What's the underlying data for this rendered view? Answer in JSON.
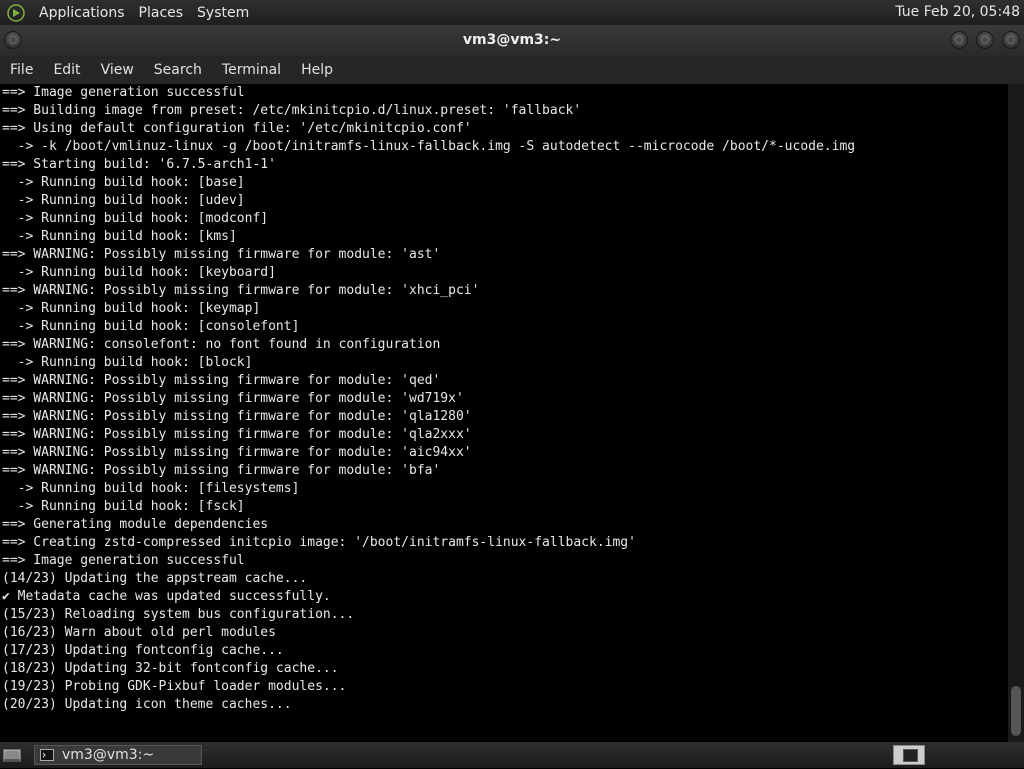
{
  "top_panel": {
    "menus": [
      "Applications",
      "Places",
      "System"
    ],
    "clock": "Tue Feb 20, 05:48"
  },
  "window": {
    "title": "vm3@vm3:~"
  },
  "menubar": {
    "items": [
      "File",
      "Edit",
      "View",
      "Search",
      "Terminal",
      "Help"
    ]
  },
  "terminal": {
    "lines": [
      "==> Image generation successful",
      "==> Building image from preset: /etc/mkinitcpio.d/linux.preset: 'fallback'",
      "==> Using default configuration file: '/etc/mkinitcpio.conf'",
      "  -> -k /boot/vmlinuz-linux -g /boot/initramfs-linux-fallback.img -S autodetect --microcode /boot/*-ucode.img",
      "==> Starting build: '6.7.5-arch1-1'",
      "  -> Running build hook: [base]",
      "  -> Running build hook: [udev]",
      "  -> Running build hook: [modconf]",
      "  -> Running build hook: [kms]",
      "==> WARNING: Possibly missing firmware for module: 'ast'",
      "  -> Running build hook: [keyboard]",
      "==> WARNING: Possibly missing firmware for module: 'xhci_pci'",
      "  -> Running build hook: [keymap]",
      "  -> Running build hook: [consolefont]",
      "==> WARNING: consolefont: no font found in configuration",
      "  -> Running build hook: [block]",
      "==> WARNING: Possibly missing firmware for module: 'qed'",
      "==> WARNING: Possibly missing firmware for module: 'wd719x'",
      "==> WARNING: Possibly missing firmware for module: 'qla1280'",
      "==> WARNING: Possibly missing firmware for module: 'qla2xxx'",
      "==> WARNING: Possibly missing firmware for module: 'aic94xx'",
      "==> WARNING: Possibly missing firmware for module: 'bfa'",
      "  -> Running build hook: [filesystems]",
      "  -> Running build hook: [fsck]",
      "==> Generating module dependencies",
      "==> Creating zstd-compressed initcpio image: '/boot/initramfs-linux-fallback.img'",
      "==> Image generation successful",
      "(14/23) Updating the appstream cache...",
      "✔ Metadata cache was updated successfully.",
      "(15/23) Reloading system bus configuration...",
      "(16/23) Warn about old perl modules",
      "(17/23) Updating fontconfig cache...",
      "(18/23) Updating 32-bit fontconfig cache...",
      "(19/23) Probing GDK-Pixbuf loader modules...",
      "(20/23) Updating icon theme caches..."
    ]
  },
  "taskbar": {
    "task_label": "vm3@vm3:~",
    "icons": {
      "show_desktop": "show-desktop-icon",
      "terminal": "terminal-icon",
      "workspace": "workspace-switcher-icon"
    }
  }
}
